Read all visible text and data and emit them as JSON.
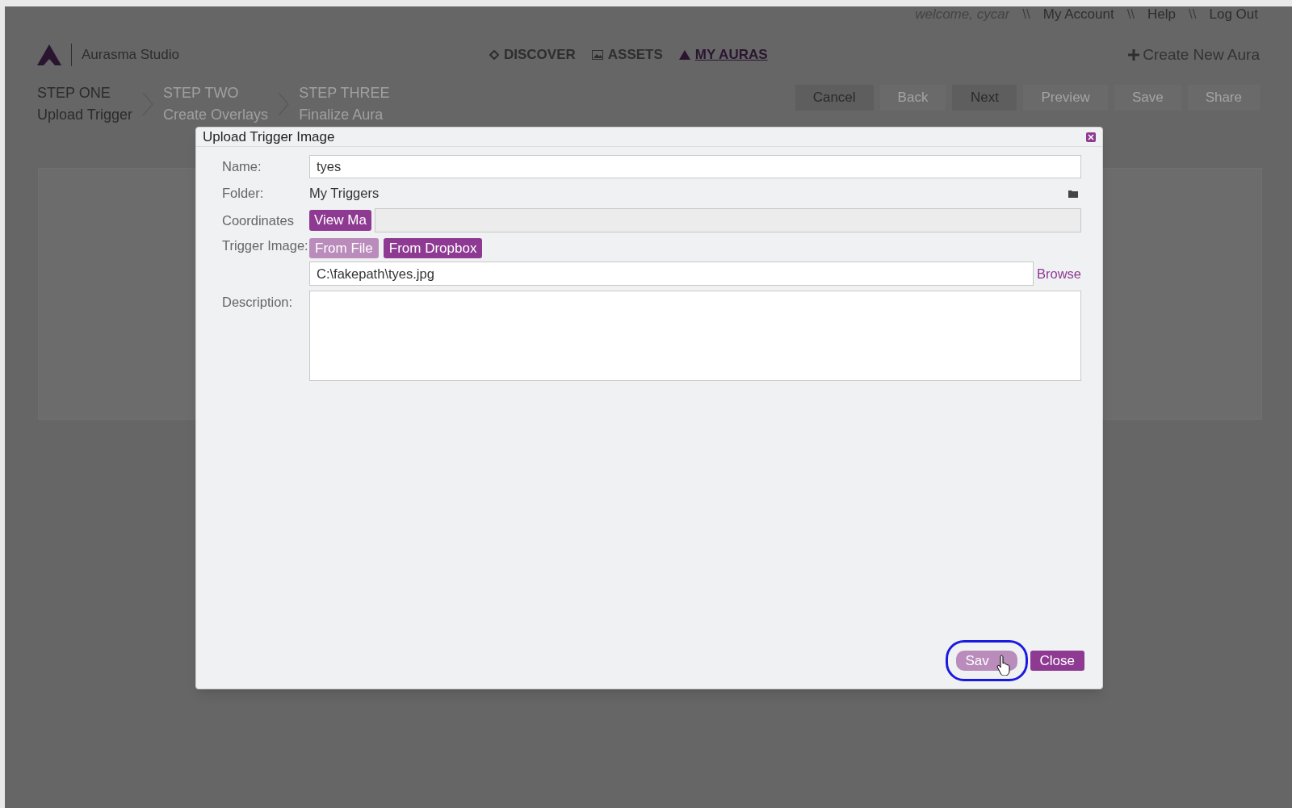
{
  "top_links": {
    "welcome": "welcome, cycar",
    "separator": "\\\\",
    "links": [
      "My Account",
      "Help",
      "Log Out"
    ]
  },
  "header": {
    "logo_text": "Aurasma Studio",
    "nav": [
      {
        "label": "DISCOVER",
        "selected": false
      },
      {
        "label": "ASSETS",
        "selected": false
      },
      {
        "label": "MY AURAS",
        "selected": true
      }
    ],
    "create": "Create New Aura"
  },
  "steps": [
    {
      "title": "STEP ONE",
      "label": "Upload Trigger",
      "selected": true
    },
    {
      "title": "STEP TWO",
      "label": "Create Overlays",
      "selected": false
    },
    {
      "title": "STEP THREE",
      "label": "Finalize Aura",
      "selected": false
    }
  ],
  "toolbar": [
    {
      "label": "Cancel",
      "disabled": false
    },
    {
      "label": "Back",
      "disabled": true
    },
    {
      "label": "Next",
      "disabled": false
    },
    {
      "label": "Preview",
      "disabled": true
    },
    {
      "label": "Save",
      "disabled": true
    },
    {
      "label": "Share",
      "disabled": true
    }
  ],
  "dialog": {
    "title": "Upload Trigger Image",
    "name": {
      "label": "Name:",
      "value": "tyes"
    },
    "folder": {
      "label": "Folder:",
      "value": "My Triggers"
    },
    "coordinates": {
      "label": "Coordinates",
      "button": "View Ma"
    },
    "trigger": {
      "label": "Trigger Image:",
      "sources": [
        {
          "label": "From File",
          "selected": true
        },
        {
          "label": "From Dropbox",
          "selected": false
        }
      ],
      "path": "C:\\fakepath\\tyes.jpg",
      "browse": "Browse"
    },
    "description": {
      "label": "Description:"
    },
    "buttons": [
      {
        "label": "Sav",
        "focused": true
      },
      {
        "label": "Close",
        "focused": false
      }
    ]
  }
}
